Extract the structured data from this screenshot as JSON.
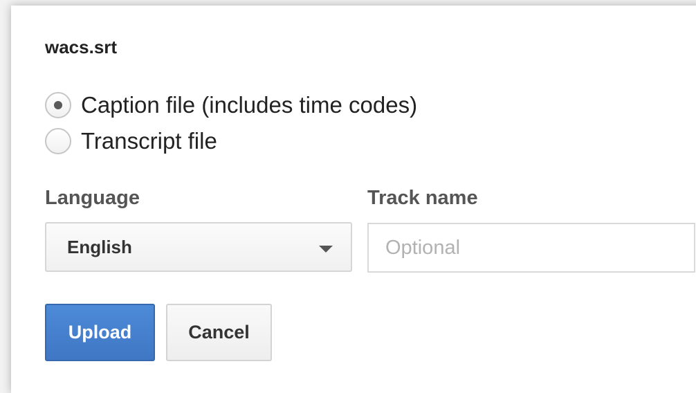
{
  "dialog": {
    "filename": "wacs.srt",
    "file_type_options": [
      {
        "label": "Caption file (includes time codes)",
        "selected": true
      },
      {
        "label": "Transcript file",
        "selected": false
      }
    ],
    "language": {
      "label": "Language",
      "selected_value": "English",
      "caret_icon": "chevron-down-icon"
    },
    "track_name": {
      "label": "Track name",
      "value": "",
      "placeholder": "Optional"
    },
    "buttons": {
      "upload_label": "Upload",
      "cancel_label": "Cancel"
    },
    "colors": {
      "primary": "#4285f4",
      "primary_border": "#3568ad",
      "text": "#222222",
      "label": "#555555"
    }
  }
}
